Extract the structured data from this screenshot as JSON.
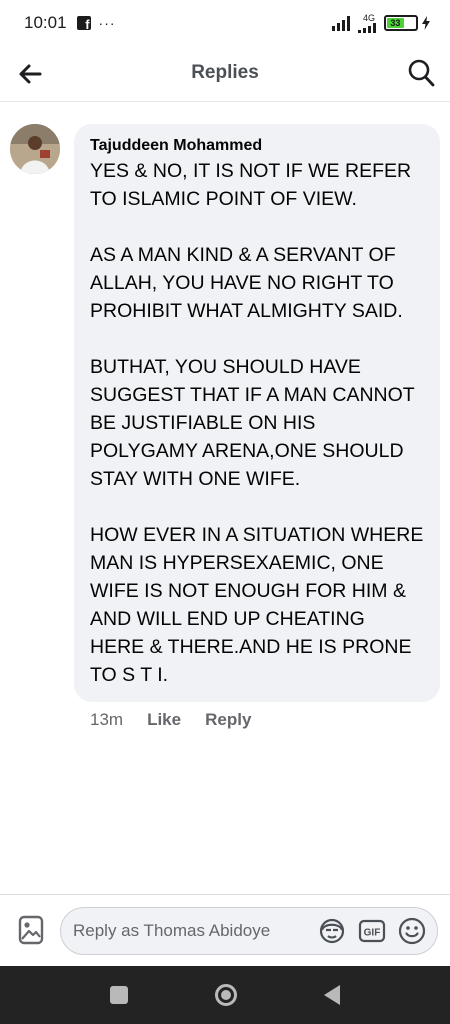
{
  "status_bar": {
    "time": "10:01",
    "dots": "···",
    "network": "4G",
    "battery": "33"
  },
  "header": {
    "title": "Replies"
  },
  "comment": {
    "author": "Tajuddeen Mohammed",
    "text": "YES & NO, IT  IS NOT IF WE REFER TO ISLAMIC POINT OF VIEW.\n\nAS A MAN KIND & A SERVANT OF ALLAH, YOU HAVE NO RIGHT TO PROHIBIT WHAT ALMIGHTY  SAID.\n\nBUTHAT, YOU SHOULD HAVE SUGGEST THAT IF A MAN CANNOT BE JUSTIFIABLE ON HIS POLYGAMY ARENA,ONE SHOULD STAY WITH ONE WIFE.\n\nHOW EVER IN A SITUATION WHERE MAN IS HYPERSEXAEMIC, ONE WIFE IS NOT ENOUGH FOR HIM & AND WILL END UP CHEATING HERE & THERE.AND HE IS PRONE TO S T I.",
    "time": "13m",
    "like_label": "Like",
    "reply_label": "Reply"
  },
  "reply_bar": {
    "placeholder": "Reply as Thomas Abidoye"
  },
  "icons": {
    "back": "arrow-left-icon",
    "search": "search-icon",
    "photo": "photo-icon",
    "avatar_sticker": "avatar-sticker-icon",
    "gif": "gif-icon",
    "emoji": "emoji-icon"
  },
  "colors": {
    "bubble": "#f0f2f5",
    "secondary_text": "#65676b",
    "nav_bar": "#232323"
  }
}
